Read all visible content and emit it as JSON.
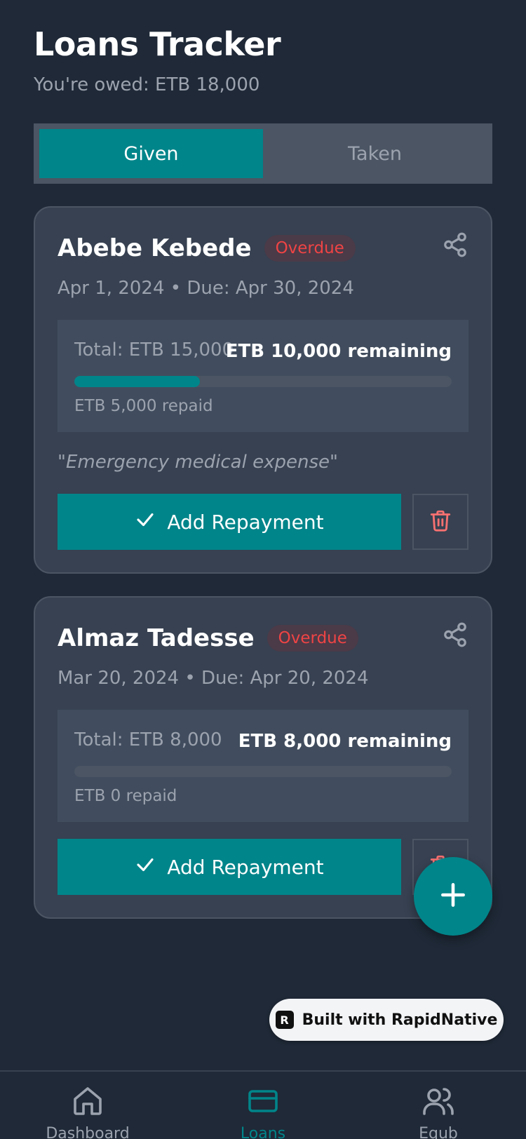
{
  "header": {
    "title": "Loans Tracker",
    "subtitle": "You're owed: ETB 18,000"
  },
  "tabs": [
    {
      "label": "Given",
      "active": true
    },
    {
      "label": "Taken",
      "active": false
    }
  ],
  "loans": [
    {
      "name": "Abebe Kebede",
      "status": "Overdue",
      "dates": "Apr 1, 2024 • Due: Apr 30, 2024",
      "total": "Total: ETB 15,000",
      "remaining": "ETB 10,000 remaining",
      "repaid": "ETB 5,000 repaid",
      "progress_fraction": 0.333,
      "note": "\"Emergency medical expense\"",
      "add_repayment_label": "Add Repayment"
    },
    {
      "name": "Almaz Tadesse",
      "status": "Overdue",
      "dates": "Mar 20, 2024 • Due: Apr 20, 2024",
      "total": "Total: ETB 8,000",
      "remaining": "ETB 8,000 remaining",
      "repaid": "ETB 0 repaid",
      "progress_fraction": 0,
      "add_repayment_label": "Add Repayment"
    }
  ],
  "badge": {
    "label": "Built with RapidNative"
  },
  "bottom_nav": [
    {
      "label": "Dashboard",
      "icon": "home-icon",
      "active": false
    },
    {
      "label": "Loans",
      "icon": "card-icon",
      "active": true
    },
    {
      "label": "Equb",
      "icon": "users-icon",
      "active": false
    }
  ],
  "colors": {
    "background": "#1f2937",
    "card": "#374151",
    "accent": "#00858a",
    "overdue": "#ef4444",
    "muted": "#9ca3af"
  }
}
